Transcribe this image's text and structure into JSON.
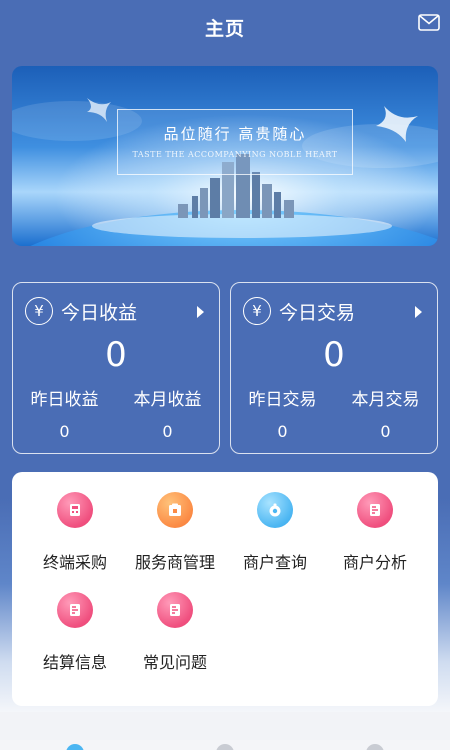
{
  "header": {
    "title": "主页",
    "mail_icon": "mail-icon"
  },
  "banner": {
    "main_text": "品位随行 高贵随心",
    "sub_text": "TASTE THE ACCOMPANYING NOBLE HEART"
  },
  "cards": [
    {
      "title": "今日收益",
      "value": "0",
      "icon": "yen-icon",
      "sub": [
        {
          "label": "昨日收益",
          "value": "0"
        },
        {
          "label": "本月收益",
          "value": "0"
        }
      ]
    },
    {
      "title": "今日交易",
      "value": "0",
      "icon": "yen-icon",
      "sub": [
        {
          "label": "昨日交易",
          "value": "0"
        },
        {
          "label": "本月交易",
          "value": "0"
        }
      ]
    }
  ],
  "menu": [
    {
      "label": "终端采购",
      "icon": "terminal-icon",
      "color": "#f0507f"
    },
    {
      "label": "服务商管理",
      "icon": "service-provider-icon",
      "color": "#fb8b45"
    },
    {
      "label": "商户查询",
      "icon": "merchant-search-icon",
      "color": "#4cb6f2"
    },
    {
      "label": "商户分析",
      "icon": "merchant-analysis-icon",
      "color": "#f0507f"
    },
    {
      "label": "结算信息",
      "icon": "settlement-icon",
      "color": "#f0507f"
    },
    {
      "label": "常见问题",
      "icon": "faq-icon",
      "color": "#f0507f"
    }
  ],
  "colors": {
    "primary": "#4a6db5",
    "accent_pink": "#f0507f",
    "accent_orange": "#fb8b45",
    "accent_blue": "#4cb6f2"
  }
}
